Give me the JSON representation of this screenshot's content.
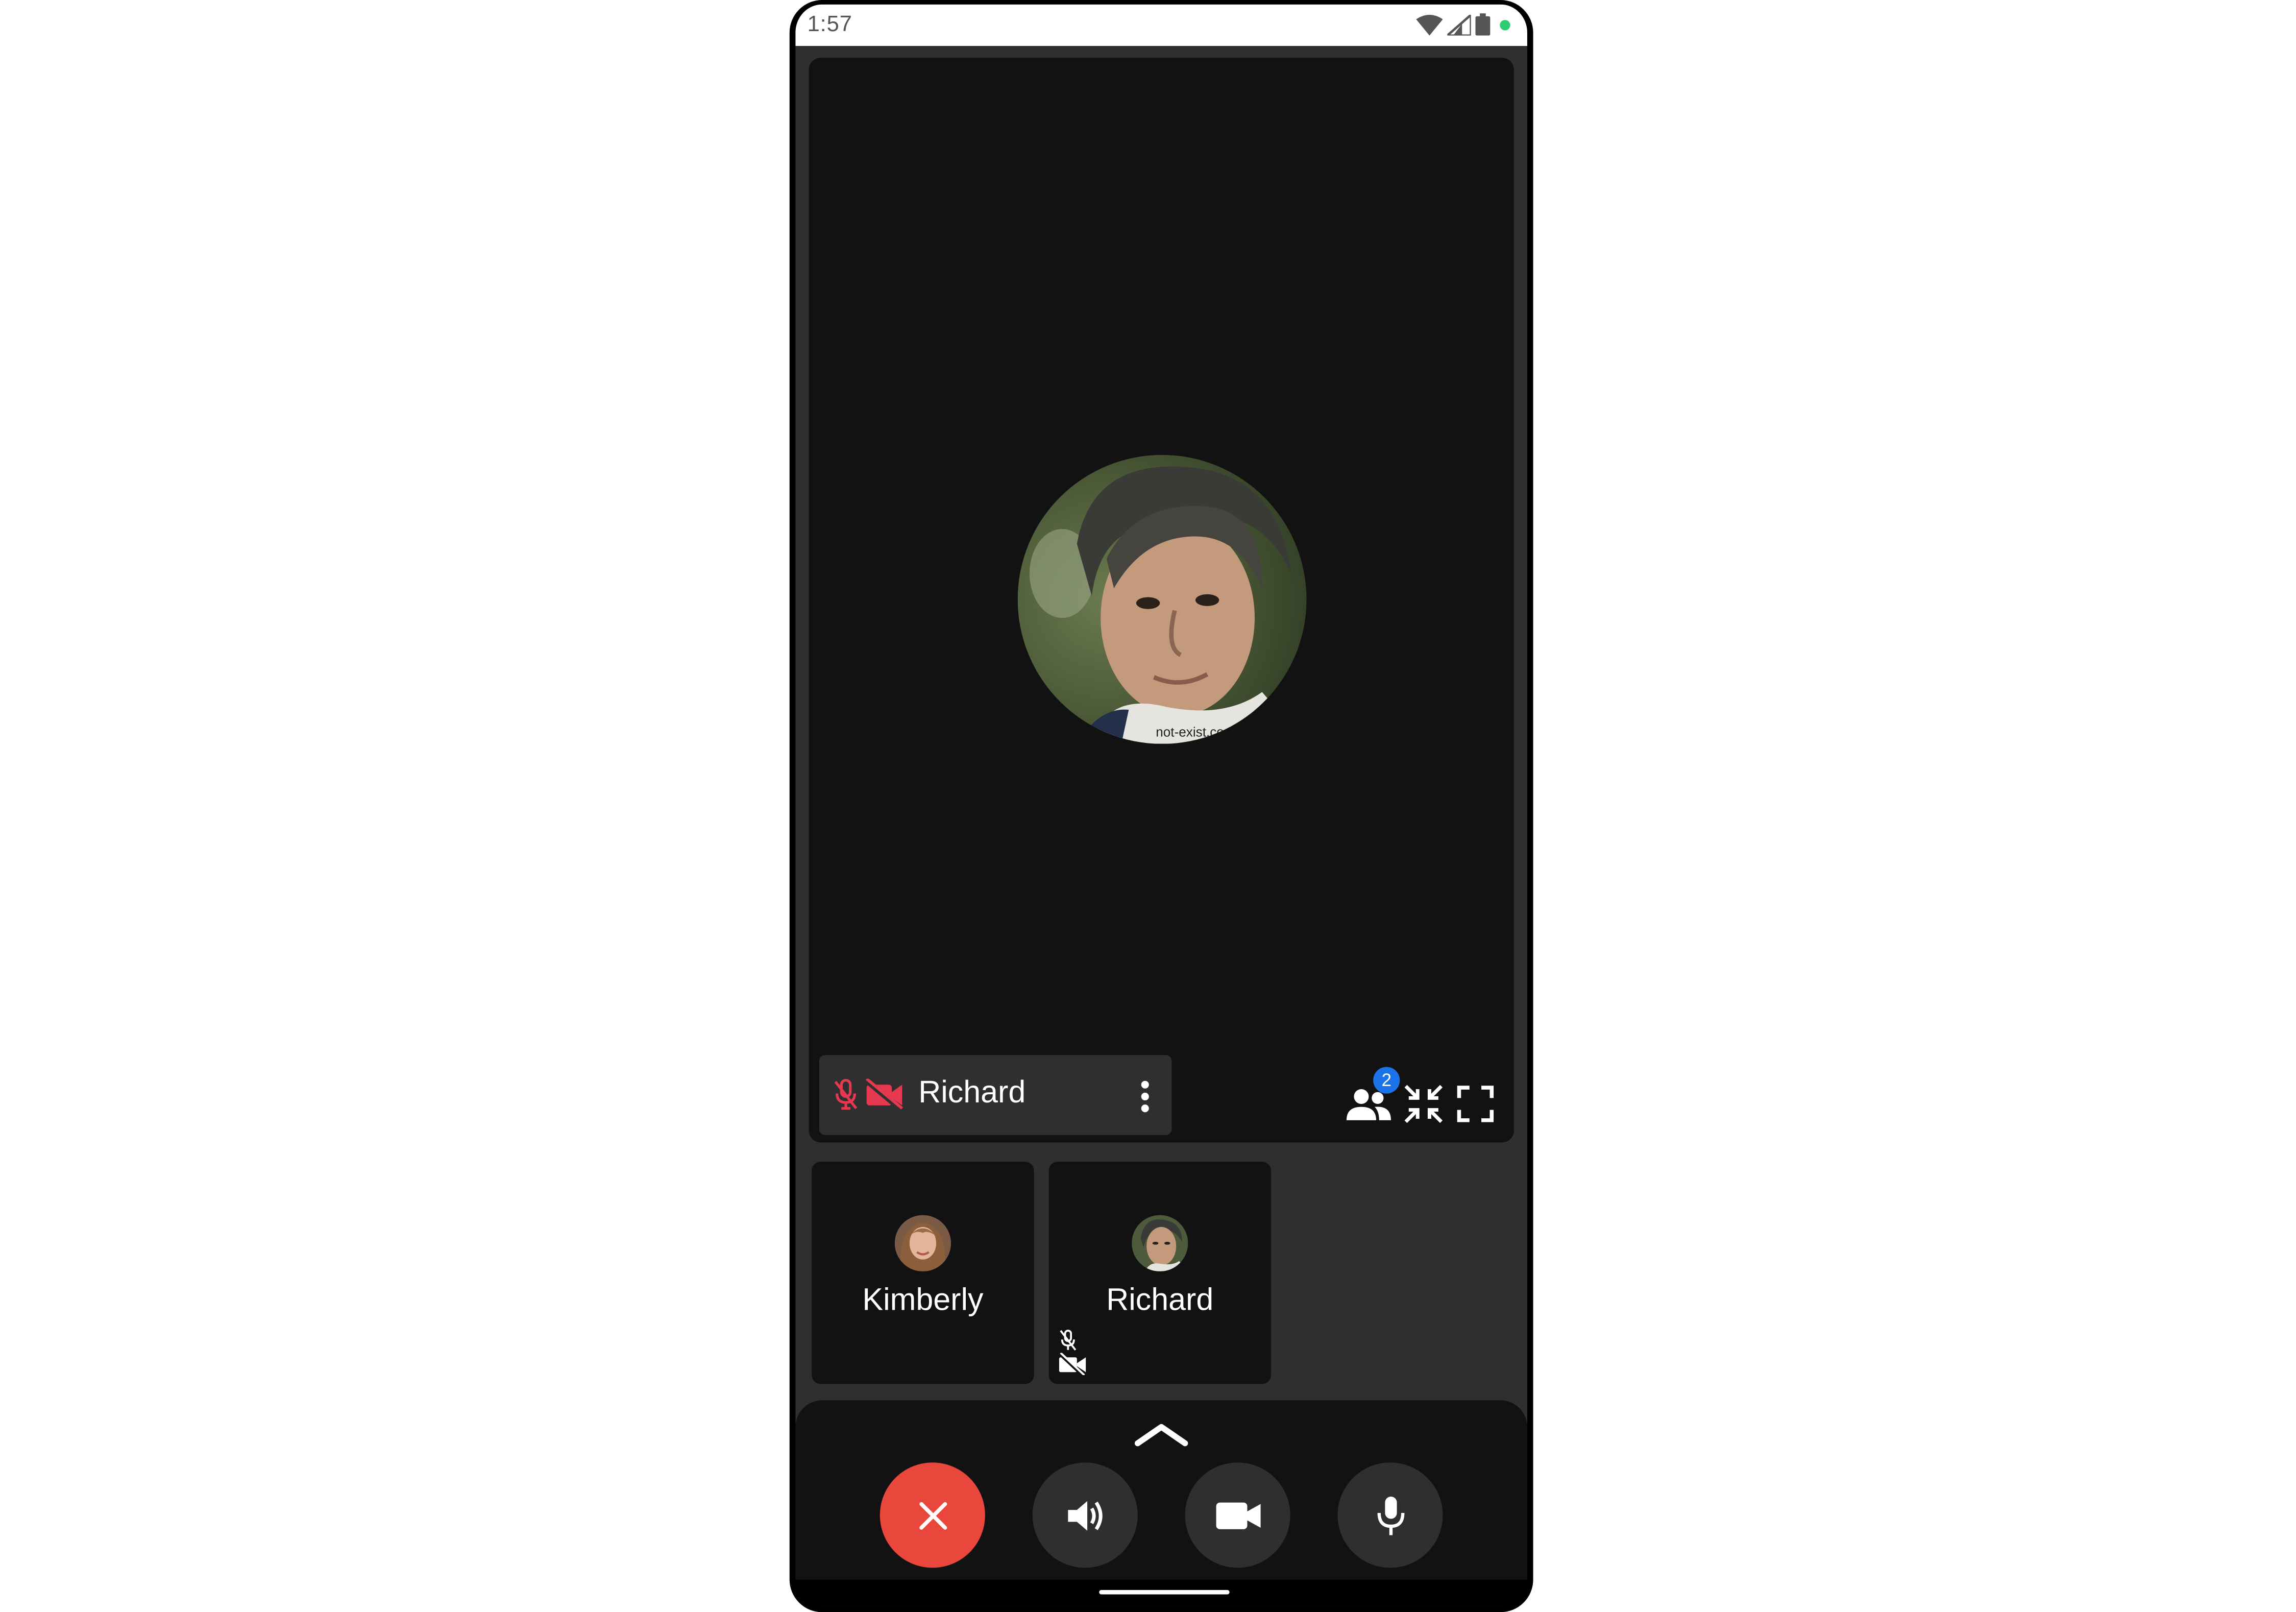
{
  "status_bar": {
    "time": "1:57"
  },
  "main_tile": {
    "participant_name": "Richard",
    "watermark": "not-exist.com",
    "participant_count": "2"
  },
  "thumbnails": [
    {
      "name": "Kimberly",
      "mic_muted": false,
      "camera_off": false
    },
    {
      "name": "Richard",
      "mic_muted": true,
      "camera_off": true
    }
  ],
  "controls": {
    "icons": [
      "close-icon",
      "speaker-icon",
      "video-camera-icon",
      "microphone-icon"
    ]
  },
  "colors": {
    "end_call": "#e9473b",
    "muted_red": "#e53950",
    "badge_blue": "#1a73e8",
    "status_dot": "#2ecc71"
  }
}
